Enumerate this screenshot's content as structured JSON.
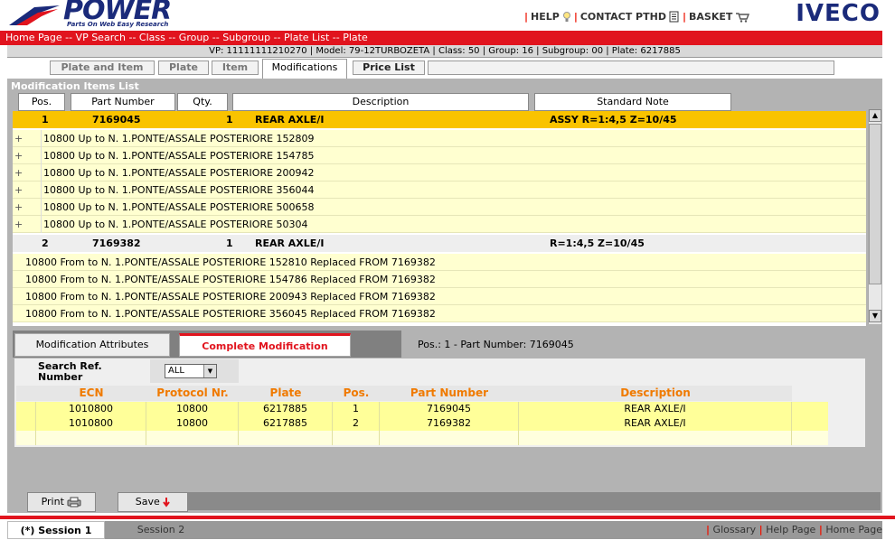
{
  "header": {
    "brand": "POWER",
    "tagline": "Parts On Web Easy Research",
    "links": [
      "HELP",
      "CONTACT PTHD",
      "BASKET"
    ],
    "oem_logo": "IVECO",
    "colors": {
      "brand_blue": "#1a2a7a",
      "accent_red": "#e1141e",
      "highlight": "#f9c300"
    }
  },
  "breadcrumb": "Home Page -- VP Search -- Class -- Group -- Subgroup -- Plate List -- Plate",
  "infobar": "VP: 11111111210270 | Model: 79-12TURBOZETA | Class: 50 | Group: 16 | Subgroup: 00 | Plate: 6217885",
  "tabs": [
    "Plate and Item",
    "Plate",
    "Item",
    "Modifications",
    "Price List"
  ],
  "list": {
    "title": "Modification Items List",
    "headers": [
      "Pos.",
      "Part Number",
      "Qty.",
      "Description",
      "Standard Note"
    ],
    "items": [
      {
        "pos": "1",
        "part": "7169045",
        "qty": "1",
        "desc": "REAR AXLE/I",
        "note": "ASSY R=1:4,5 Z=10/45",
        "children": [
          "10800 Up to N. 1.PONTE/ASSALE POSTERIORE  152809",
          "10800 Up to N. 1.PONTE/ASSALE POSTERIORE  154785",
          "10800 Up to N. 1.PONTE/ASSALE POSTERIORE  200942",
          "10800 Up to N. 1.PONTE/ASSALE POSTERIORE  356044",
          "10800 Up to N. 1.PONTE/ASSALE POSTERIORE  500658",
          "10800 Up to N. 1.PONTE/ASSALE POSTERIORE  50304"
        ]
      },
      {
        "pos": "2",
        "part": "7169382",
        "qty": "1",
        "desc": "REAR AXLE/I",
        "note": "R=1:4,5 Z=10/45",
        "children": [
          "10800 From to N. 1.PONTE/ASSALE POSTERIORE 152810 Replaced FROM 7169382",
          "10800 From to N. 1.PONTE/ASSALE POSTERIORE 154786 Replaced FROM 7169382",
          "10800 From to N. 1.PONTE/ASSALE POSTERIORE 200943 Replaced FROM 7169382",
          "10800 From to N. 1.PONTE/ASSALE POSTERIORE 356045 Replaced FROM 7169382"
        ]
      }
    ]
  },
  "lower_tabs": [
    "Modification Attributes",
    "Complete Modification"
  ],
  "pos_info": "Pos.:  1 - Part Number:  7169045",
  "search": {
    "label": "Search Ref. Number",
    "selected": "ALL"
  },
  "attributes": {
    "headers": [
      "ECN",
      "Protocol Nr.",
      "Plate",
      "Pos.",
      "Part Number",
      "Description"
    ],
    "rows": [
      [
        "1010800",
        "10800",
        "6217885",
        "1",
        "7169045",
        "REAR AXLE/I"
      ],
      [
        "1010800",
        "10800",
        "6217885",
        "2",
        "7169382",
        "REAR AXLE/I"
      ]
    ]
  },
  "toolbar": {
    "print": "Print",
    "save": "Save"
  },
  "sessions": [
    "(*) Session 1",
    "Session 2"
  ],
  "footer_links": [
    "Glossary",
    "Help Page",
    "Home Page"
  ]
}
